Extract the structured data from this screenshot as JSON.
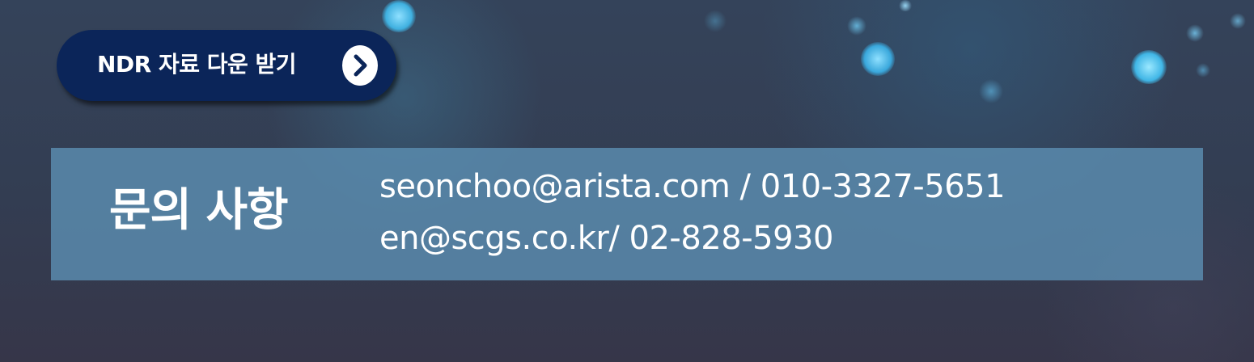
{
  "download": {
    "label": "NDR 자료 다운 받기",
    "icon": "chevron-right-icon"
  },
  "contact": {
    "title": "문의 사항",
    "lines": [
      "seonchoo@arista.com / 010-3327-5651",
      "en@scgs.co.kr/ 02-828-5930"
    ]
  },
  "colors": {
    "button_bg": "#0b2559",
    "panel_bg": "#5b8db1",
    "background": "#34435a",
    "bokeh_accent": "#4fc3f0"
  }
}
